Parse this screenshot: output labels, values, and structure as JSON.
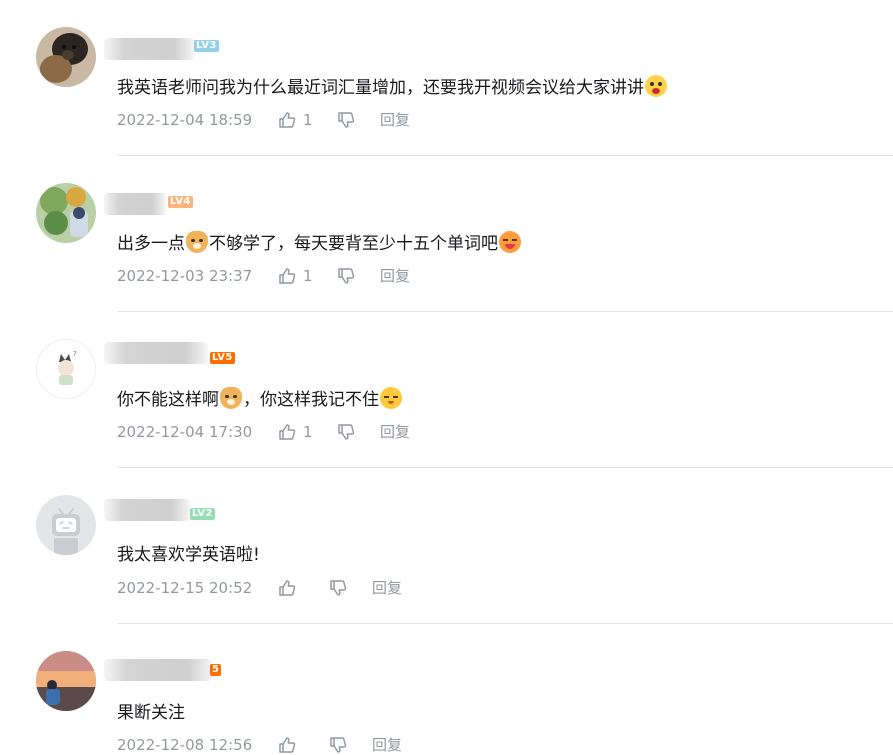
{
  "colors": {
    "text": "#18191c",
    "meta": "#9499a0",
    "divider": "#e3e5e7",
    "lv2": "#95ddb2",
    "lv3": "#92d1e5",
    "lv4": "#ffb37c",
    "lv5": "#ff6c00"
  },
  "comments": [
    {
      "level": "LV3",
      "text": "我英语老师问我为什么最近词汇量增加，还要我开视频会议给大家讲讲",
      "emoji_after": "shock-emoji",
      "date": "2022-12-04 18:59",
      "likes": "1",
      "reply": "回复"
    },
    {
      "level": "LV4",
      "text_part1": "出多一点",
      "text_part2": "不够学了，每天要背至少十五个单词吧",
      "emoji_mid": "dog-emoji",
      "emoji_after": "drool-emoji",
      "date": "2022-12-03 23:37",
      "likes": "1",
      "reply": "回复"
    },
    {
      "level": "LV5",
      "text_part1": "你不能这样啊",
      "text_part2": "，你这样我记不住",
      "emoji_mid": "dog-emoji",
      "emoji_after": "sleepy-emoji",
      "date": "2022-12-04 17:30",
      "likes": "1",
      "reply": "回复"
    },
    {
      "level": "LV2",
      "text": "我太喜欢学英语啦!",
      "date": "2022-12-15 20:52",
      "likes": "",
      "reply": "回复"
    },
    {
      "level": "5",
      "text": "果断关注",
      "date": "2022-12-08 12:56",
      "likes": "",
      "reply": "回复"
    }
  ]
}
